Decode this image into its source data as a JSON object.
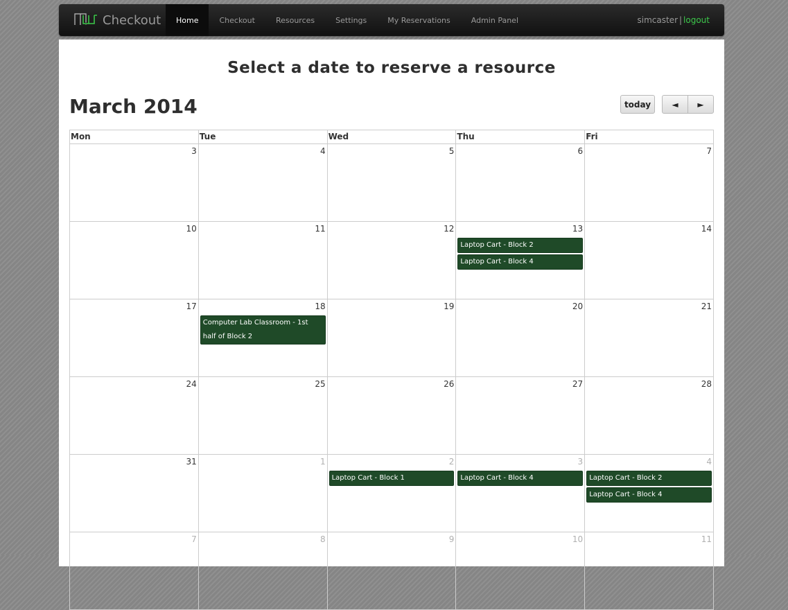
{
  "nav": {
    "brand": "Checkout",
    "items": [
      "Home",
      "Checkout",
      "Resources",
      "Settings",
      "My Reservations",
      "Admin Panel"
    ],
    "active_index": 0,
    "username": "simcaster",
    "separator": "|",
    "logout": "logout"
  },
  "page": {
    "title": "Select a date to reserve a resource",
    "month": "March 2014",
    "today_label": "today",
    "prev_label": "◄",
    "next_label": "►"
  },
  "calendar": {
    "headers": [
      "Mon",
      "Tue",
      "Wed",
      "Thu",
      "Fri"
    ],
    "weeks": [
      [
        {
          "day": "3"
        },
        {
          "day": "4"
        },
        {
          "day": "5"
        },
        {
          "day": "6"
        },
        {
          "day": "7"
        }
      ],
      [
        {
          "day": "10"
        },
        {
          "day": "11"
        },
        {
          "day": "12"
        },
        {
          "day": "13",
          "events": [
            "Laptop Cart - Block 2",
            "Laptop Cart - Block 4"
          ]
        },
        {
          "day": "14"
        }
      ],
      [
        {
          "day": "17"
        },
        {
          "day": "18",
          "events": [
            "Computer Lab Classroom - 1st half of Block 2"
          ]
        },
        {
          "day": "19"
        },
        {
          "day": "20"
        },
        {
          "day": "21"
        }
      ],
      [
        {
          "day": "24"
        },
        {
          "day": "25"
        },
        {
          "day": "26"
        },
        {
          "day": "27"
        },
        {
          "day": "28"
        }
      ],
      [
        {
          "day": "31"
        },
        {
          "day": "1",
          "other": true
        },
        {
          "day": "2",
          "other": true,
          "events": [
            "Laptop Cart - Block 1"
          ]
        },
        {
          "day": "3",
          "other": true,
          "events": [
            "Laptop Cart - Block 4"
          ]
        },
        {
          "day": "4",
          "other": true,
          "events": [
            "Laptop Cart - Block 2",
            "Laptop Cart - Block 4"
          ]
        }
      ],
      [
        {
          "day": "7",
          "other": true
        },
        {
          "day": "8",
          "other": true
        },
        {
          "day": "9",
          "other": true
        },
        {
          "day": "10",
          "other": true
        },
        {
          "day": "11",
          "other": true
        }
      ]
    ]
  },
  "colors": {
    "event_bg": "#1f4a28",
    "logout_link": "#3cc74a"
  }
}
